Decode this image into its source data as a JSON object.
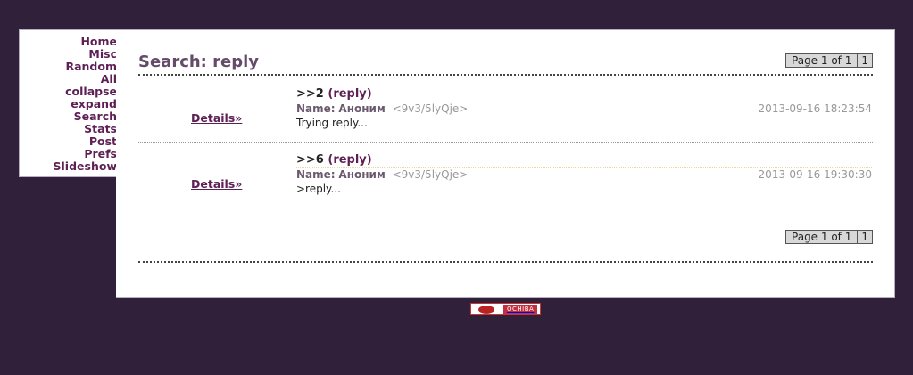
{
  "nav": {
    "items": [
      "Home",
      "Misc",
      "Random",
      "All",
      "collapse",
      "expand",
      "Search",
      "Stats",
      "Post",
      "Prefs",
      "Slideshow"
    ]
  },
  "page": {
    "title": "Search: reply",
    "pager_label": "Page 1 of 1",
    "pager_page": "1"
  },
  "posts": [
    {
      "details": "Details»",
      "ref": ">>2",
      "subject": "(reply)",
      "name_label": "Name:",
      "name": "Аноним",
      "trip": "<9v3/5lyQje>",
      "date": "2013-09-16 18:23:54",
      "body": "Trying reply..."
    },
    {
      "details": "Details»",
      "ref": ">>6",
      "subject": "(reply)",
      "name_label": "Name:",
      "name": "Аноним",
      "trip": "<9v3/5lyQje>",
      "date": "2013-09-16 19:30:30",
      "body": ">reply..."
    }
  ],
  "footer": {
    "badge_text": "OCHIBA"
  },
  "colors": {
    "background": "#30203a",
    "link": "#5e1f55",
    "title": "#654b6a"
  }
}
